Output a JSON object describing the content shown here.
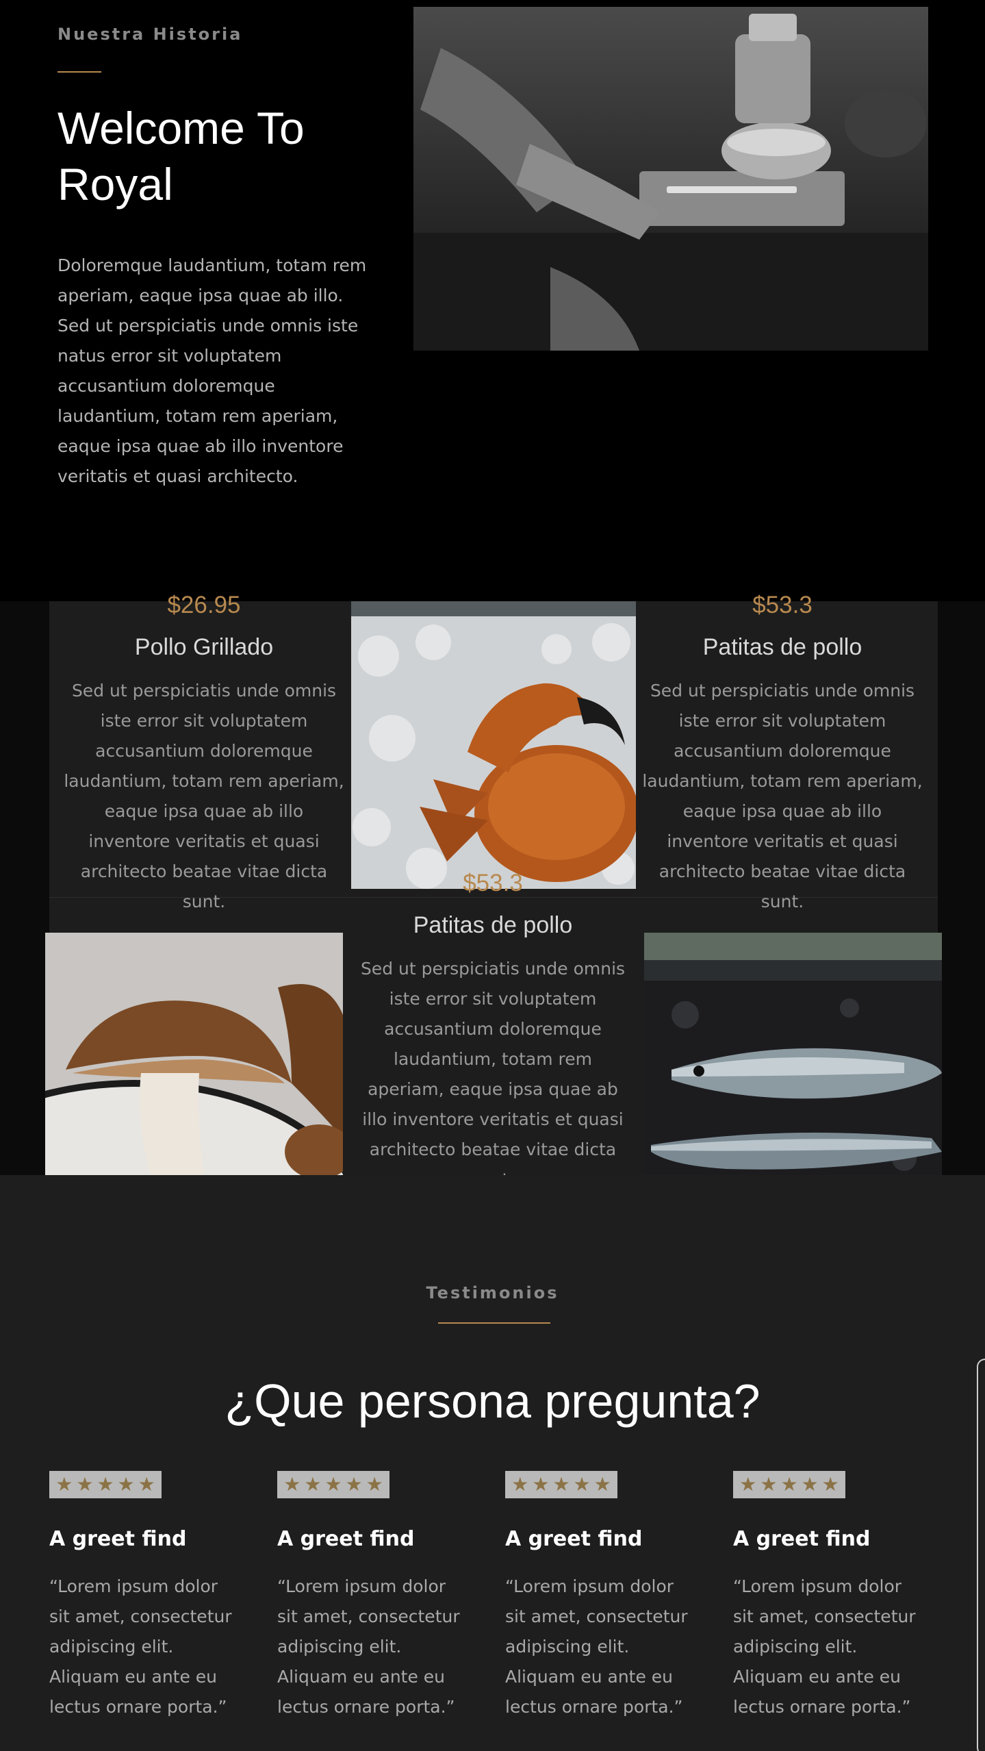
{
  "story": {
    "eyebrow": "Nuestra Historia",
    "title": "Welcome To Royal",
    "body": "Doloremque laudantium, totam rem aperiam, eaque ipsa quae ab illo. Sed ut perspiciatis unde omnis iste natus error sit voluptatem accusantium doloremque laudantium, totam rem aperiam, eaque ipsa quae ab illo inventore veritatis et quasi architecto."
  },
  "menu": {
    "items": [
      {
        "price": "$26.95",
        "name": "Pollo Grillado",
        "description": "Sed ut perspiciatis unde omnis iste error sit voluptatem accusantium doloremque laudantium, totam rem aperiam, eaque ipsa quae ab illo inventore veritatis et quasi architecto beatae vitae dicta sunt."
      },
      {
        "price": "$53.3",
        "name": "Patitas de pollo",
        "description": "Sed ut perspiciatis unde omnis iste error sit voluptatem accusantium doloremque laudantium, totam rem aperiam, eaque ipsa quae ab illo inventore veritatis et quasi architecto beatae vitae dicta sunt."
      },
      {
        "price": "$53.3",
        "name": "Patitas de pollo",
        "description": "Sed ut perspiciatis unde omnis iste error sit voluptatem accusantium doloremque laudantium, totam rem aperiam, eaque ipsa quae ab illo inventore veritatis et quasi architecto beatae vitae dicta sunt."
      }
    ]
  },
  "testimonials": {
    "eyebrow": "Testimonios",
    "title": "¿Que persona pregunta?",
    "cards": [
      {
        "title": "A greet find",
        "text": "“Lorem ipsum dolor sit amet, consectetur adipiscing elit. Aliquam eu ante eu lectus ornare porta.”"
      },
      {
        "title": "A greet find",
        "text": "“Lorem ipsum dolor sit amet, consectetur adipiscing elit. Aliquam eu ante eu lectus ornare porta.”"
      },
      {
        "title": "A greet find",
        "text": "“Lorem ipsum dolor sit amet, consectetur adipiscing elit. Aliquam eu ante eu lectus ornare porta.”"
      },
      {
        "title": "A greet find",
        "text": "“Lorem ipsum dolor sit amet, consectetur adipiscing elit. Aliquam eu ante eu lectus ornare porta.”"
      }
    ],
    "star_rating": 5,
    "star_glyph": "★"
  },
  "colors": {
    "accent": "#b8894f",
    "background": "#000000",
    "panel": "#1d1d1d"
  }
}
